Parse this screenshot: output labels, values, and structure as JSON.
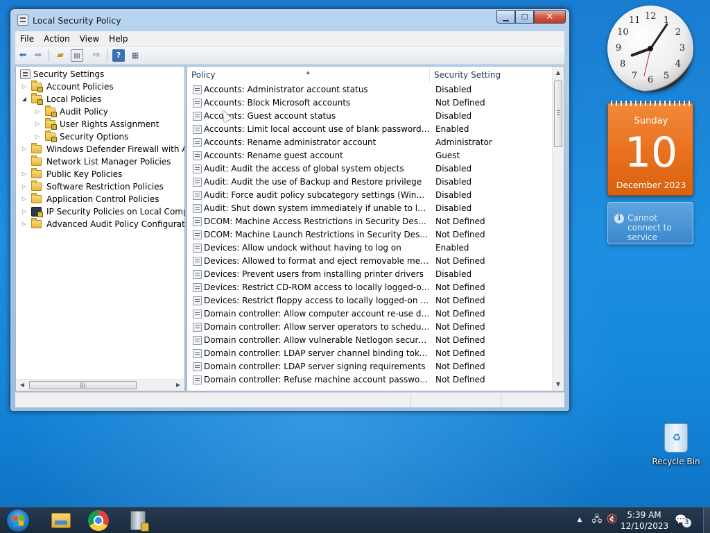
{
  "window": {
    "title": "Local Security Policy",
    "controls": {
      "minimize": "▁",
      "maximize": "☐",
      "close": "✕"
    }
  },
  "menu": [
    "File",
    "Action",
    "View",
    "Help"
  ],
  "toolbar": {
    "icons": [
      "back-arrow-icon",
      "forward-arrow-icon",
      "up-folder-icon",
      "show-hide-tree-icon",
      "export-list-icon",
      "help-icon",
      "properties-icon"
    ]
  },
  "tree": {
    "items": [
      {
        "label": "Security Settings",
        "level": 0,
        "toggle": "",
        "icon": "sec"
      },
      {
        "label": "Account Policies",
        "level": 1,
        "toggle": "▷",
        "icon": "folder-locked"
      },
      {
        "label": "Local Policies",
        "level": 1,
        "toggle": "◢",
        "icon": "folder-locked"
      },
      {
        "label": "Audit Policy",
        "level": 2,
        "toggle": "▷",
        "icon": "folder-locked"
      },
      {
        "label": "User Rights Assignment",
        "level": 2,
        "toggle": "▷",
        "icon": "folder-locked"
      },
      {
        "label": "Security Options",
        "level": 2,
        "toggle": "▷",
        "icon": "folder-locked"
      },
      {
        "label": "Windows Defender Firewall with Adva",
        "level": 1,
        "toggle": "▷",
        "icon": "folder"
      },
      {
        "label": "Network List Manager Policies",
        "level": 1,
        "toggle": "",
        "icon": "folder"
      },
      {
        "label": "Public Key Policies",
        "level": 1,
        "toggle": "▷",
        "icon": "folder"
      },
      {
        "label": "Software Restriction Policies",
        "level": 1,
        "toggle": "▷",
        "icon": "folder"
      },
      {
        "label": "Application Control Policies",
        "level": 1,
        "toggle": "▷",
        "icon": "folder"
      },
      {
        "label": "IP Security Policies on Local Compute",
        "level": 1,
        "toggle": "▷",
        "icon": "ipsec"
      },
      {
        "label": "Advanced Audit Policy Configuration",
        "level": 1,
        "toggle": "▷",
        "icon": "folder"
      }
    ]
  },
  "list": {
    "columns": [
      "Policy",
      "Security Setting"
    ],
    "sort_indicator": "▲",
    "rows": [
      {
        "policy": "Accounts: Administrator account status",
        "setting": "Disabled"
      },
      {
        "policy": "Accounts: Block Microsoft accounts",
        "setting": "Not Defined"
      },
      {
        "policy": "Accounts: Guest account status",
        "setting": "Disabled"
      },
      {
        "policy": "Accounts: Limit local account use of blank passwords to co...",
        "setting": "Enabled"
      },
      {
        "policy": "Accounts: Rename administrator account",
        "setting": "Administrator"
      },
      {
        "policy": "Accounts: Rename guest account",
        "setting": "Guest"
      },
      {
        "policy": "Audit: Audit the access of global system objects",
        "setting": "Disabled"
      },
      {
        "policy": "Audit: Audit the use of Backup and Restore privilege",
        "setting": "Disabled"
      },
      {
        "policy": "Audit: Force audit policy subcategory settings (Windows Vis...",
        "setting": "Disabled"
      },
      {
        "policy": "Audit: Shut down system immediately if unable to log secur...",
        "setting": "Disabled"
      },
      {
        "policy": "DCOM: Machine Access Restrictions in Security Descriptor D...",
        "setting": "Not Defined"
      },
      {
        "policy": "DCOM: Machine Launch Restrictions in Security Descriptor ...",
        "setting": "Not Defined"
      },
      {
        "policy": "Devices: Allow undock without having to log on",
        "setting": "Enabled"
      },
      {
        "policy": "Devices: Allowed to format and eject removable media",
        "setting": "Not Defined"
      },
      {
        "policy": "Devices: Prevent users from installing printer drivers",
        "setting": "Disabled"
      },
      {
        "policy": "Devices: Restrict CD-ROM access to locally logged-on user ...",
        "setting": "Not Defined"
      },
      {
        "policy": "Devices: Restrict floppy access to locally logged-on user only",
        "setting": "Not Defined"
      },
      {
        "policy": "Domain controller: Allow computer account re-use during d...",
        "setting": "Not Defined"
      },
      {
        "policy": "Domain controller: Allow server operators to schedule tasks",
        "setting": "Not Defined"
      },
      {
        "policy": "Domain controller: Allow vulnerable Netlogon secure chann...",
        "setting": "Not Defined"
      },
      {
        "policy": "Domain controller: LDAP server channel binding token requi...",
        "setting": "Not Defined"
      },
      {
        "policy": "Domain controller: LDAP server signing requirements",
        "setting": "Not Defined"
      },
      {
        "policy": "Domain controller: Refuse machine account password chan...",
        "setting": "Not Defined"
      }
    ]
  },
  "gadgets": {
    "clock_numbers": [
      "12",
      "1",
      "2",
      "3",
      "4",
      "5",
      "6",
      "7",
      "8",
      "9",
      "10",
      "11"
    ],
    "calendar": {
      "weekday": "Sunday",
      "day": "10",
      "month_year": "December 2023"
    },
    "weather": {
      "message": "Cannot connect to service"
    }
  },
  "desktop": {
    "recycle_bin": "Recycle Bin"
  },
  "taskbar": {
    "apps": [
      "file-explorer-icon",
      "chrome-icon",
      "local-security-policy-icon"
    ],
    "tray": {
      "show_hidden": "▲",
      "time": "5:39 AM",
      "date": "12/10/2023",
      "notifications": "3"
    }
  },
  "colors": {
    "accent": "#1e8fe0",
    "calendar": "#e8701e",
    "close_button": "#c43b22"
  }
}
